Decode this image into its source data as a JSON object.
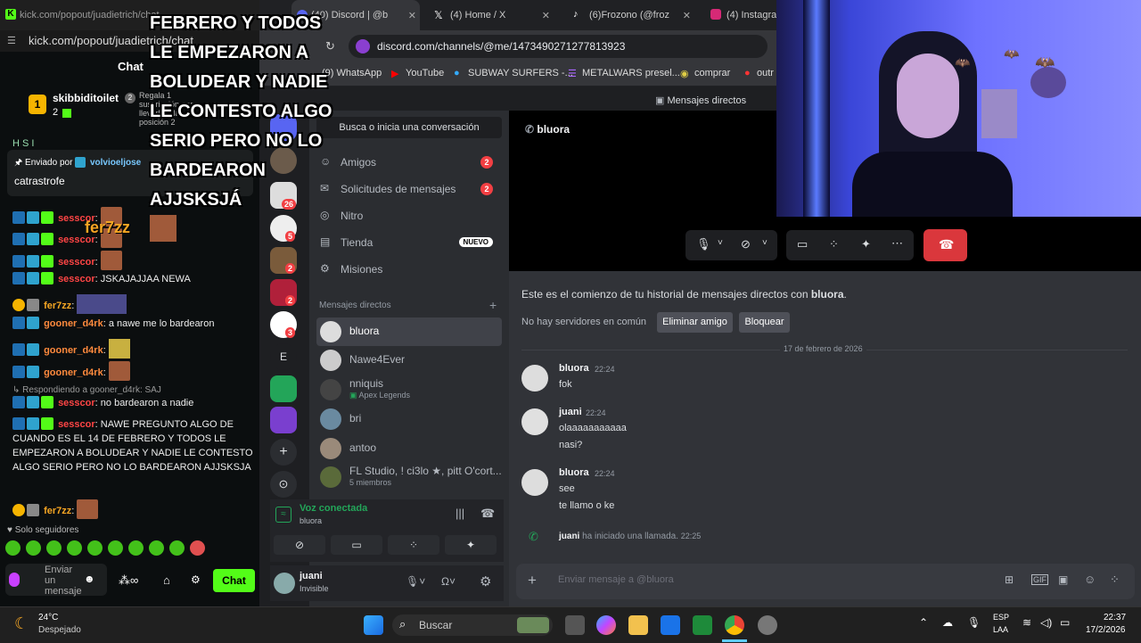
{
  "kick": {
    "tab_title": "kick.com/popout/juadietrich/chat",
    "url": "kick.com/popout/juadietrich/chat",
    "chat_header": "Chat",
    "top_user": "skibbiditoilet",
    "top_count": "2",
    "gift_text": "Regala 1 suscripción para llevarlo a la posición 2",
    "pinned_prefix": "Enviado por",
    "pinned_user": "volvioeljose",
    "pinned_text": "catrastrofe",
    "faded_line": "H S I",
    "messages": [
      {
        "user": "sesscor",
        "text": ""
      },
      {
        "user": "sesscor",
        "text": ""
      },
      {
        "user": "sesscor",
        "text": ""
      },
      {
        "user": "sesscor",
        "text": "JSKAJAJJAA NEWA"
      },
      {
        "user": "fer7zz",
        "text": ""
      },
      {
        "user": "gooner_d4rk",
        "text": "a nawe me lo bardearon"
      },
      {
        "user": "gooner_d4rk",
        "text": ""
      },
      {
        "user": "gooner_d4rk",
        "text": ""
      },
      {
        "user": "sesscor",
        "text": "no bardearon a nadie"
      },
      {
        "user": "sesscor",
        "text": "NAWE PREGUNTO ALGO DE CUANDO ES EL 14 DE FEBRERO Y TODOS LE EMPEZARON A BOLUDEAR Y NADIE LE CONTESTO ALGO SERIO PERO NO LO BARDEARON AJJSKSJA"
      },
      {
        "user": "fer7zz",
        "text": ""
      }
    ],
    "reply_to": "Respondiendo a gooner_d4rk: SAJ",
    "floating_name": "fer7zz",
    "followers_only": "Solo seguidores",
    "input_placeholder": "Enviar un mensaje",
    "chat_button": "Chat"
  },
  "overlay_text": "FEBRERO Y TODOS LE EMPEZARON A BOLUDEAR Y NADIE LE CONTESTO ALGO SERIO PERO NO LO BARDEARON AJJSKSJÁ",
  "browser": {
    "tabs": [
      {
        "label": "(40) Discord | @b"
      },
      {
        "label": "(4) Home / X"
      },
      {
        "label": "(6)Frozono (@frozon"
      },
      {
        "label": "(4) Instagram"
      }
    ],
    "url": "discord.com/channels/@me/1473490271277813923",
    "bookmarks": [
      "(9) WhatsApp",
      "YouTube",
      "SUBWAY SURFERS -...",
      "METALWARS presel...",
      "comprar",
      "outr"
    ]
  },
  "discord": {
    "header_title": "Mensajes directos",
    "search_placeholder": "Busca o inicia una conversación",
    "nav": [
      {
        "label": "Amigos",
        "badge": "2"
      },
      {
        "label": "Solicitudes de mensajes",
        "badge": "2"
      },
      {
        "label": "Nitro",
        "badge": ""
      },
      {
        "label": "Tienda",
        "tag": "NUEVO"
      },
      {
        "label": "Misiones",
        "badge": ""
      }
    ],
    "server_badges": [
      "26",
      "5",
      "2",
      "2",
      "3"
    ],
    "server_letter": "E",
    "dm_section": "Mensajes directos",
    "dms": [
      {
        "name": "bluora",
        "sub": ""
      },
      {
        "name": "Nawe4Ever",
        "sub": ""
      },
      {
        "name": "nniquis",
        "sub": "Apex Legends"
      },
      {
        "name": "bri",
        "sub": ""
      },
      {
        "name": "antoo",
        "sub": ""
      },
      {
        "name": "FL Studio, ! ci3lo ★, pitt O'cort...",
        "sub": "5 miembros"
      }
    ],
    "voice_status": "Voz conectada",
    "voice_channel": "bluora",
    "user_name": "juani",
    "user_status": "Invisible",
    "channel_name": "bluora",
    "history_start": "Este es el comienzo de tu historial de mensajes directos con",
    "history_user": "bluora",
    "no_servers": "No hay servidores en común",
    "remove_friend": "Eliminar amigo",
    "block": "Bloquear",
    "date_divider": "17 de febrero de 2026",
    "messages": [
      {
        "user": "bluora",
        "time": "22:24",
        "lines": [
          "fok"
        ]
      },
      {
        "user": "juani",
        "time": "22:24",
        "lines": [
          "olaaaaaaaaaaa",
          "nasi?"
        ]
      },
      {
        "user": "bluora",
        "time": "22:24",
        "lines": [
          "see",
          "te llamo o ke"
        ]
      }
    ],
    "call_user": "juani",
    "call_text": "ha iniciado una llamada.",
    "call_time": "22:25",
    "input_placeholder": "Enviar mensaje a @bluora"
  },
  "taskbar": {
    "temp": "24°C",
    "weather": "Despejado",
    "search": "Buscar",
    "lang1": "ESP",
    "lang2": "LAA",
    "time": "22:37",
    "date": "17/2/2026"
  }
}
